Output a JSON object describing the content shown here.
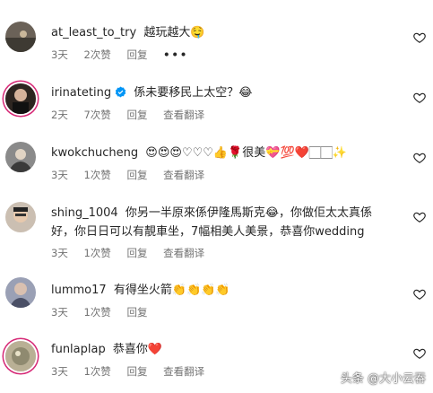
{
  "comments": [
    {
      "username": "at_least_to_try",
      "text": "越玩越大🤤",
      "time": "3天",
      "likes": "2次赞",
      "reply": "回复",
      "more": "•••"
    },
    {
      "username": "irinateting",
      "text": "係未要移民上太空？😂",
      "time": "2天",
      "likes": "7次赞",
      "reply": "回复",
      "translate": "查看翻译"
    },
    {
      "username": "kwokchucheng",
      "text": "😍😍😍♡♡♡👍🌹很美💝💯❤️🏻🏻✨",
      "time": "3天",
      "likes": "1次赞",
      "reply": "回复",
      "translate": "查看翻译"
    },
    {
      "username": "shing_1004",
      "text_line1": "你另一半原來係伊隆馬斯克😂，你做佢太太真係",
      "text_line2": "好，你日日可以有靚車坐，7幅相美人美景，恭喜你wedding",
      "time": "3天",
      "likes": "1次赞",
      "reply": "回复",
      "translate": "查看翻译"
    },
    {
      "username": "lummo17",
      "text": "有得坐火箭👏👏👏👏",
      "time": "3天",
      "likes": "1次赞",
      "reply": "回复"
    },
    {
      "username": "funlaplap",
      "text": "恭喜你❤️",
      "time": "3天",
      "likes": "1次赞",
      "reply": "回复",
      "translate": "查看翻译"
    }
  ],
  "watermark": "头条 @大小云吞",
  "colors": {
    "text": "#262626",
    "meta": "#737373",
    "verified": "#0095f6",
    "story_ring": "#d62976"
  },
  "icons": {
    "like": "heart-outline-icon",
    "verified": "verified-badge-icon"
  }
}
